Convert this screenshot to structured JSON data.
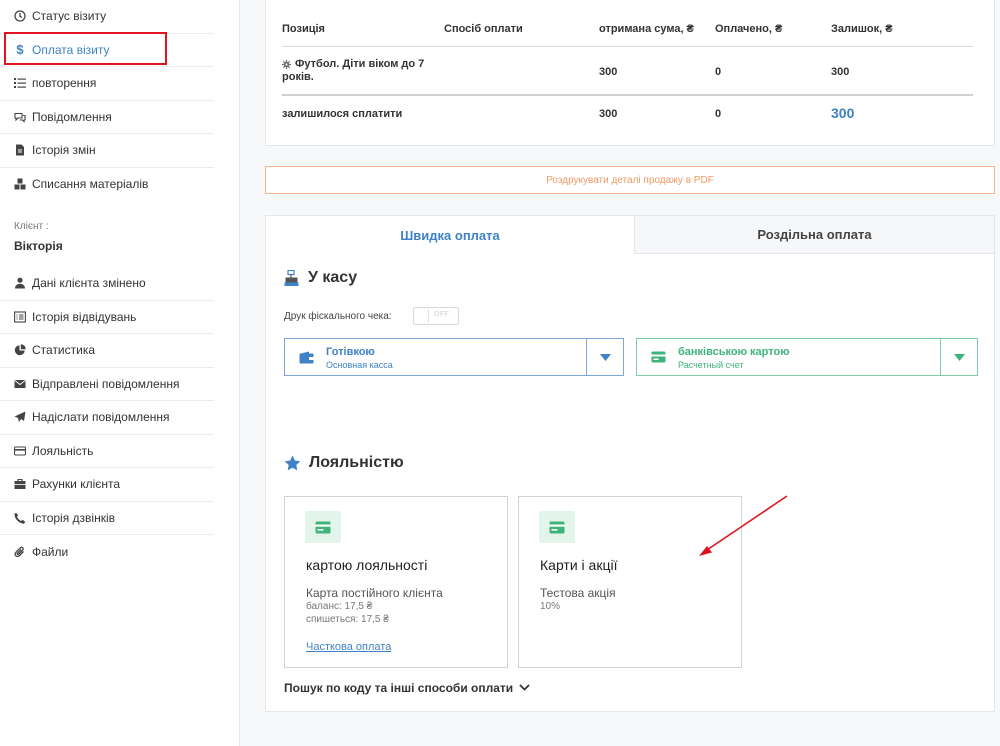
{
  "sidebar": {
    "items": [
      {
        "label": "Статус візиту",
        "icon": "clock-icon"
      },
      {
        "label": "Оплата візиту",
        "icon": "dollar-icon",
        "active": true
      },
      {
        "label": "повторення",
        "icon": "list-icon"
      },
      {
        "label": "Повідомлення",
        "icon": "chat-icon"
      },
      {
        "label": "Історія змін",
        "icon": "file-icon"
      },
      {
        "label": "Списання матеріалів",
        "icon": "cubes-icon"
      }
    ],
    "client_label": "Клієнт :",
    "client_name": "Вікторія",
    "client_items": [
      {
        "label": "Дані клієнта змінено",
        "icon": "user-icon"
      },
      {
        "label": "Історія відвідувань",
        "icon": "list-alt-icon"
      },
      {
        "label": "Статистика",
        "icon": "pie-chart-icon"
      },
      {
        "label": "Відправлені повідомлення",
        "icon": "envelope-icon"
      },
      {
        "label": "Надіслати повідомлення",
        "icon": "send-icon"
      },
      {
        "label": "Лояльність",
        "icon": "card-icon"
      },
      {
        "label": "Рахунки клієнта",
        "icon": "briefcase-icon"
      },
      {
        "label": "Історія дзвінків",
        "icon": "phone-icon"
      },
      {
        "label": "Файли",
        "icon": "paperclip-icon"
      }
    ]
  },
  "table": {
    "headers": [
      "Позиція",
      "Спосіб оплати",
      "отримана сума, ₴",
      "Оплачено, ₴",
      "Залишок, ₴"
    ],
    "row": {
      "position_line1": "Футбол. Діти віком до 7",
      "position_line2": "років.",
      "received": "300",
      "paid": "0",
      "rest": "300"
    },
    "total": {
      "label": "залишилося сплатити",
      "received": "300",
      "paid": "0",
      "rest": "300"
    }
  },
  "pdf_button": "Роздрукувати деталі продажу в PDF",
  "tabs": [
    {
      "label": "Швидка оплата",
      "active": true
    },
    {
      "label": "Роздільна оплата",
      "active": false
    }
  ],
  "cash_section": {
    "title": "У касу",
    "fiscal_label": "Друк фіскального чека:",
    "toggle_state": "OFF",
    "cash": {
      "title": "Готівкою",
      "subtitle": "Основная касса"
    },
    "card": {
      "title": "банківською картою",
      "subtitle": "Расчетный счет"
    }
  },
  "loyalty_section": {
    "title": "Лояльністю",
    "card_a": {
      "title": "картою лояльності",
      "line1": "Карта постійного клієнта",
      "line2": "баланс: 17,5 ₴",
      "line3": "спишеться: 17,5 ₴",
      "link": "Часткова оплата"
    },
    "card_b": {
      "title": "Карти і акції",
      "line1": "Тестова акція",
      "line2": "10%"
    },
    "search_more": "Пошук по коду та інші способи оплати"
  },
  "colors": {
    "accent_blue": "#3f82c6",
    "accent_green": "#3fb47a",
    "highlight_red": "#e0141e",
    "pdf_orange": "#f29a62"
  }
}
